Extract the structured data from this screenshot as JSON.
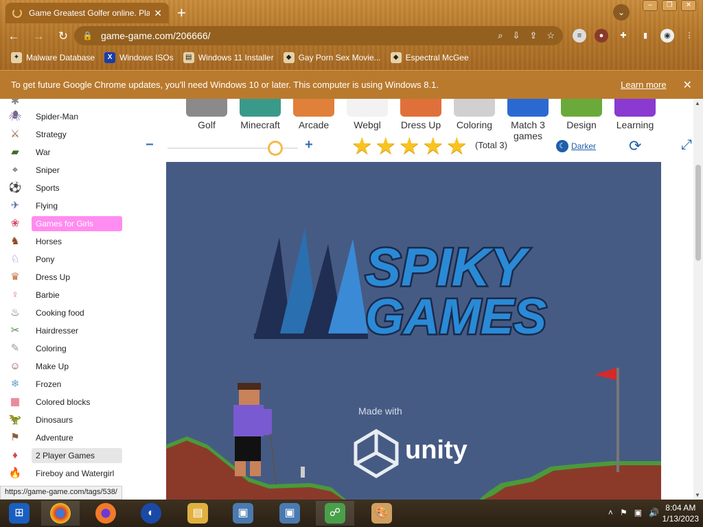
{
  "browser": {
    "tab_title": "Game Greatest Golfer online. Pla",
    "tab_close": "✕",
    "new_tab": "+",
    "url": "game-game.com/206666/",
    "bookmarks": [
      {
        "label": "Malware Database",
        "icon": "malware-icon"
      },
      {
        "label": "Windows ISOs",
        "icon": "x-icon"
      },
      {
        "label": "Windows 11 Installer",
        "icon": "installer-icon"
      },
      {
        "label": "Gay Porn Sex Movie...",
        "icon": "bookmark-icon"
      },
      {
        "label": "Espectral McGee",
        "icon": "bookmark-icon"
      }
    ]
  },
  "infobar": {
    "message": "To get future Google Chrome updates, you'll need Windows 10 or later. This computer is using Windows 8.1.",
    "learn_more": "Learn more",
    "close": "✕"
  },
  "sidebar": {
    "items": [
      {
        "label": "Spider-Man",
        "icon": "spiderman-icon",
        "color": "#6b5a8a"
      },
      {
        "label": "Strategy",
        "icon": "strategy-icon",
        "color": "#8a5a3b"
      },
      {
        "label": "War",
        "icon": "tank-icon",
        "color": "#3f6b2c"
      },
      {
        "label": "Sniper",
        "icon": "sniper-icon",
        "color": "#333333"
      },
      {
        "label": "Sports",
        "icon": "ball-icon",
        "color": "#222222"
      },
      {
        "label": "Flying",
        "icon": "plane-icon",
        "color": "#5a6ba8"
      },
      {
        "label": "Games for Girls",
        "icon": "girl-icon",
        "color": "#d84a6a"
      },
      {
        "label": "Horses",
        "icon": "horse-icon",
        "color": "#8a4a22"
      },
      {
        "label": "Pony",
        "icon": "pony-icon",
        "color": "#9a6ad0"
      },
      {
        "label": "Dress Up",
        "icon": "dressup-icon",
        "color": "#c26a3a"
      },
      {
        "label": "Barbie",
        "icon": "barbie-icon",
        "color": "#e26aa0"
      },
      {
        "label": "Cooking food",
        "icon": "chef-icon",
        "color": "#5a5a5a"
      },
      {
        "label": "Hairdresser",
        "icon": "scissors-icon",
        "color": "#4a8a4a"
      },
      {
        "label": "Coloring",
        "icon": "coloring-icon",
        "color": "#aaaaaa"
      },
      {
        "label": "Make Up",
        "icon": "makeup-icon",
        "color": "#8a4a3a"
      },
      {
        "label": "Frozen",
        "icon": "frozen-icon",
        "color": "#6aa0d0"
      },
      {
        "label": "Colored blocks",
        "icon": "blocks-icon",
        "color": "#e04a6a"
      },
      {
        "label": "Dinosaurs",
        "icon": "dinosaur-icon",
        "color": "#8a6a4a"
      },
      {
        "label": "Adventure",
        "icon": "adventure-icon",
        "color": "#8a5a3a"
      },
      {
        "label": "2 Player Games",
        "icon": "twoplayer-icon",
        "color": "#d04a4a"
      },
      {
        "label": "Fireboy and Watergirl",
        "icon": "fireboy-icon",
        "color": "#e06a2a"
      }
    ]
  },
  "categories": [
    {
      "label": "Golf",
      "color": "#8a8a8a"
    },
    {
      "label": "Minecraft",
      "color": "#3a9a8a"
    },
    {
      "label": "Arcade",
      "color": "#e0803a"
    },
    {
      "label": "Webgl",
      "color": "#eeeeee"
    },
    {
      "label": "Dress Up",
      "color": "#e0703a"
    },
    {
      "label": "Coloring",
      "color": "#cccccc"
    },
    {
      "label": "Match 3 games",
      "color": "#2a6ad0"
    },
    {
      "label": "Design",
      "color": "#6aaa3a"
    },
    {
      "label": "Learning",
      "color": "#8a3ad0"
    }
  ],
  "rating": {
    "stars": 5,
    "total": "(Total 3)"
  },
  "toolbar": {
    "darker": "Darker"
  },
  "game": {
    "logo_line1": "SPIKY",
    "logo_line2": "GAMES",
    "made_with": "Made with",
    "engine": "unity"
  },
  "status_url": "https://game-game.com/tags/538/",
  "taskbar": {
    "apps": [
      "start",
      "chrome",
      "firefox",
      "obama-icon",
      "explorer",
      "setup-1",
      "setup-2",
      "network",
      "paint"
    ],
    "time": "8:04 AM",
    "date": "1/13/2023"
  },
  "colors": {
    "accent_pink": "#ff8cf0",
    "link_blue": "#1e5faa",
    "game_bg": "#465b84",
    "star": "#f9c322"
  }
}
